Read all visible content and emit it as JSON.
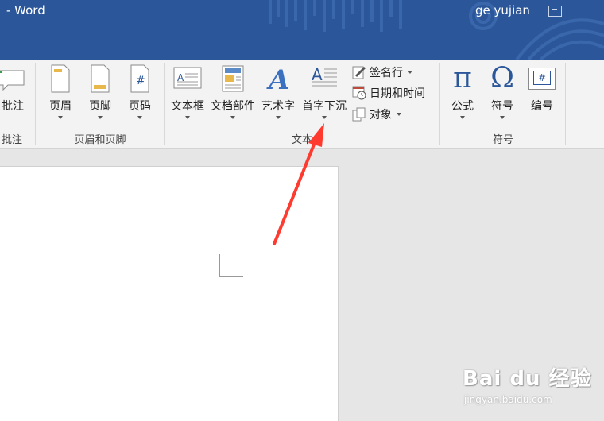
{
  "titlebar": {
    "app_title": "- Word",
    "user_name": "ge yujian",
    "brand_color": "#2b579a"
  },
  "ribbon": {
    "groups": {
      "comments": {
        "label": "批注",
        "buttons": [
          {
            "label": "批注",
            "icon": "new-comment-icon"
          }
        ]
      },
      "header_footer": {
        "label": "页眉和页脚",
        "buttons": [
          {
            "label": "页眉",
            "icon": "header-icon"
          },
          {
            "label": "页脚",
            "icon": "footer-icon"
          },
          {
            "label": "页码",
            "icon": "page-number-icon"
          }
        ]
      },
      "text": {
        "label": "文本",
        "buttons": [
          {
            "label": "文本框",
            "icon": "text-box-icon"
          },
          {
            "label": "文档部件",
            "icon": "quick-parts-icon"
          },
          {
            "label": "艺术字",
            "icon": "wordart-icon"
          },
          {
            "label": "首字下沉",
            "icon": "drop-cap-icon"
          }
        ],
        "small_buttons": [
          {
            "label": "签名行",
            "icon": "signature-line-icon",
            "has_dropdown": true
          },
          {
            "label": "日期和时间",
            "icon": "date-time-icon",
            "has_dropdown": false
          },
          {
            "label": "对象",
            "icon": "object-icon",
            "has_dropdown": true
          }
        ]
      },
      "symbols": {
        "label": "符号",
        "buttons": [
          {
            "label": "公式",
            "icon": "equation-pi-icon",
            "glyph": "π"
          },
          {
            "label": "符号",
            "icon": "symbol-omega-icon",
            "glyph": "Ω"
          },
          {
            "label": "编号",
            "icon": "numbering-icon",
            "glyph": "#"
          }
        ]
      }
    }
  },
  "annotation": {
    "arrow_color": "#ff3b30"
  },
  "watermark": {
    "brand": "Bai du 经验",
    "url": "jingyan.baidu.com"
  }
}
